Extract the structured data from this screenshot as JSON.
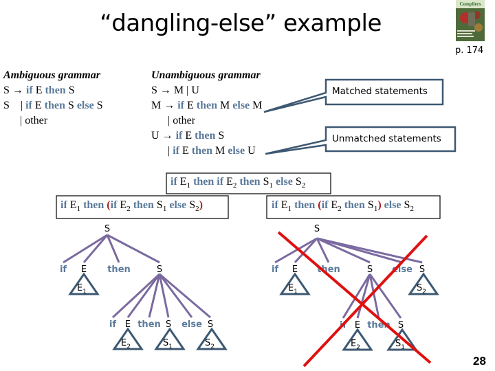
{
  "title": "“dangling-else” example",
  "book_ref": {
    "cover_title": "Compilers",
    "page": "p. 174"
  },
  "ambiguous": {
    "heading": "Ambiguous grammar",
    "lines": [
      [
        {
          "t": "S → ",
          "k": false
        },
        {
          "t": "if",
          "k": true
        },
        {
          "t": " E ",
          "k": false
        },
        {
          "t": "then",
          "k": true
        },
        {
          "t": " S",
          "k": false
        }
      ],
      [
        {
          "t": "S    | ",
          "k": false
        },
        {
          "t": "if",
          "k": true
        },
        {
          "t": " E ",
          "k": false
        },
        {
          "t": "then",
          "k": true
        },
        {
          "t": " S ",
          "k": false
        },
        {
          "t": "else",
          "k": true
        },
        {
          "t": " S",
          "k": false
        }
      ],
      [
        {
          "t": "      | other",
          "k": false
        }
      ]
    ]
  },
  "unambiguous": {
    "heading": "Unambiguous grammar",
    "lines": [
      [
        {
          "t": "S → M | U",
          "k": false
        }
      ],
      [
        {
          "t": "M → ",
          "k": false
        },
        {
          "t": "if",
          "k": true
        },
        {
          "t": " E ",
          "k": false
        },
        {
          "t": "then",
          "k": true
        },
        {
          "t": " M ",
          "k": false
        },
        {
          "t": "else",
          "k": true
        },
        {
          "t": " M",
          "k": false
        }
      ],
      [
        {
          "t": "      | other",
          "k": false
        }
      ],
      [
        {
          "t": "U → ",
          "k": false
        },
        {
          "t": "if",
          "k": true
        },
        {
          "t": " E ",
          "k": false
        },
        {
          "t": "then",
          "k": true
        },
        {
          "t": " S",
          "k": false
        }
      ],
      [
        {
          "t": "      | ",
          "k": false
        },
        {
          "t": "if",
          "k": true
        },
        {
          "t": " E ",
          "k": false
        },
        {
          "t": "then",
          "k": true
        },
        {
          "t": " M ",
          "k": false
        },
        {
          "t": "else",
          "k": true
        },
        {
          "t": " U",
          "k": false
        }
      ]
    ]
  },
  "callouts": {
    "matched": "Matched statements",
    "unmatched": "Unmatched statements"
  },
  "sentence": [
    {
      "t": "if",
      "c": "kw"
    },
    {
      "t": " E",
      "c": ""
    },
    {
      "t": "1",
      "c": "sub"
    },
    {
      "t": " then if",
      "c": "kw"
    },
    {
      "t": " E",
      "c": ""
    },
    {
      "t": "2",
      "c": "sub"
    },
    {
      "t": " then",
      "c": "kw"
    },
    {
      "t": " S",
      "c": ""
    },
    {
      "t": "1",
      "c": "sub"
    },
    {
      "t": " else",
      "c": "kw"
    },
    {
      "t": " S",
      "c": ""
    },
    {
      "t": "2",
      "c": "sub"
    }
  ],
  "interpretations": {
    "left": [
      {
        "t": "if",
        "c": "kw"
      },
      {
        "t": " E",
        "c": ""
      },
      {
        "t": "1",
        "c": "sub"
      },
      {
        "t": " then ",
        "c": "kw"
      },
      {
        "t": "(",
        "c": "paren"
      },
      {
        "t": "if",
        "c": "kw"
      },
      {
        "t": " E",
        "c": ""
      },
      {
        "t": "2",
        "c": "sub"
      },
      {
        "t": " then",
        "c": "kw"
      },
      {
        "t": " S",
        "c": ""
      },
      {
        "t": "1",
        "c": "sub"
      },
      {
        "t": " else",
        "c": "kw"
      },
      {
        "t": " S",
        "c": ""
      },
      {
        "t": "2",
        "c": "sub"
      },
      {
        "t": ")",
        "c": "paren"
      }
    ],
    "right": [
      {
        "t": "if",
        "c": "kw"
      },
      {
        "t": " E",
        "c": ""
      },
      {
        "t": "1",
        "c": "sub"
      },
      {
        "t": " then ",
        "c": "kw"
      },
      {
        "t": "(",
        "c": "paren"
      },
      {
        "t": "if",
        "c": "kw"
      },
      {
        "t": " E",
        "c": ""
      },
      {
        "t": "2",
        "c": "sub"
      },
      {
        "t": " then",
        "c": "kw"
      },
      {
        "t": " S",
        "c": ""
      },
      {
        "t": "1",
        "c": "sub"
      },
      {
        "t": ")",
        "c": "paren"
      },
      {
        "t": " else",
        "c": "kw"
      },
      {
        "t": " S",
        "c": ""
      },
      {
        "t": "2",
        "c": "sub"
      }
    ]
  },
  "trees": {
    "left": {
      "root": "S",
      "children": [
        "if",
        "E",
        "then",
        "S"
      ],
      "e_subtree": {
        "base": "E",
        "sub": "1"
      },
      "inner_children": [
        "if",
        "E",
        "then",
        "S",
        "else",
        "S"
      ],
      "inner_subtrees": [
        {
          "base": "E",
          "sub": "2"
        },
        {
          "base": "S",
          "sub": "1"
        },
        {
          "base": "S",
          "sub": "2"
        }
      ],
      "rejected": false
    },
    "right": {
      "root": "S",
      "children": [
        "if",
        "E",
        "then",
        "S",
        "else",
        "S"
      ],
      "e_subtree": {
        "base": "E",
        "sub": "1"
      },
      "s2_subtree": {
        "base": "S",
        "sub": "2"
      },
      "inner_children": [
        "if",
        "E",
        "then",
        "S"
      ],
      "inner_subtrees": [
        {
          "base": "E",
          "sub": "2"
        },
        {
          "base": "S",
          "sub": "1"
        }
      ],
      "rejected": true
    }
  },
  "colors": {
    "keyword": "#5b7a9a",
    "paren": "#b01c1c",
    "tree_edge": "#7b6aa0",
    "triangle": "#3d5872",
    "callout_border": "#3d5872",
    "reject_cross": "#e01010"
  },
  "slide_number": "28"
}
